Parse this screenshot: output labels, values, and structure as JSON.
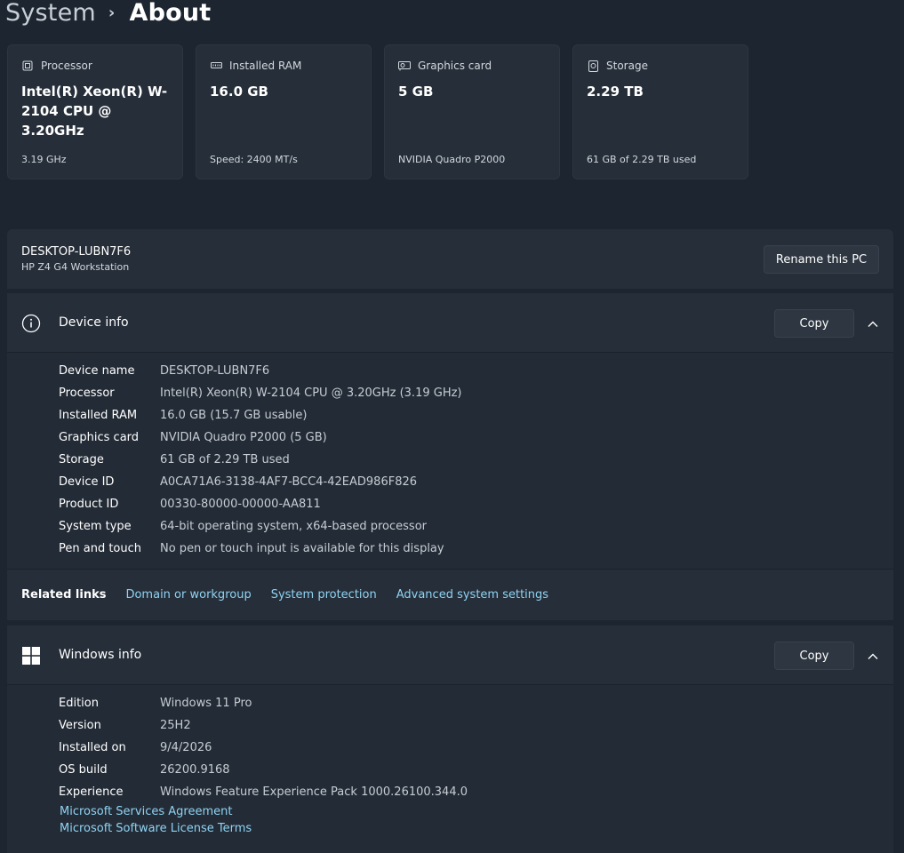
{
  "breadcrumb": {
    "parent": "System",
    "separator": "›",
    "current": "About"
  },
  "cards": [
    {
      "icon": "processor-icon",
      "label": "Processor",
      "value": "Intel(R) Xeon(R) W-2104 CPU @ 3.20GHz",
      "sub": "3.19 GHz"
    },
    {
      "icon": "ram-icon",
      "label": "Installed RAM",
      "value": "16.0 GB",
      "sub": "Speed: 2400 MT/s"
    },
    {
      "icon": "graphics-card-icon",
      "label": "Graphics card",
      "value": "5 GB",
      "sub": "NVIDIA Quadro P2000"
    },
    {
      "icon": "storage-icon",
      "label": "Storage",
      "value": "2.29 TB",
      "sub": "61 GB of 2.29 TB used"
    }
  ],
  "pc": {
    "name": "DESKTOP-LUBN7F6",
    "model": "HP Z4 G4 Workstation",
    "rename_label": "Rename this PC"
  },
  "device_info": {
    "title": "Device info",
    "copy_label": "Copy",
    "rows": [
      {
        "k": "Device name",
        "v": "DESKTOP-LUBN7F6"
      },
      {
        "k": "Processor",
        "v": "Intel(R) Xeon(R) W-2104 CPU @ 3.20GHz (3.19 GHz)"
      },
      {
        "k": "Installed RAM",
        "v": "16.0 GB (15.7 GB usable)"
      },
      {
        "k": "Graphics card",
        "v": "NVIDIA Quadro P2000 (5 GB)"
      },
      {
        "k": "Storage",
        "v": "61 GB of 2.29 TB used"
      },
      {
        "k": "Device ID",
        "v": "A0CA71A6-3138-4AF7-BCC4-42EAD986F826"
      },
      {
        "k": "Product ID",
        "v": "00330-80000-00000-AA811"
      },
      {
        "k": "System type",
        "v": "64-bit operating system, x64-based processor"
      },
      {
        "k": "Pen and touch",
        "v": "No pen or touch input is available for this display"
      }
    ]
  },
  "related_links": {
    "label": "Related links",
    "links": [
      "Domain or workgroup",
      "System protection",
      "Advanced system settings"
    ]
  },
  "windows_info": {
    "title": "Windows info",
    "copy_label": "Copy",
    "rows": [
      {
        "k": "Edition",
        "v": "Windows 11 Pro"
      },
      {
        "k": "Version",
        "v": "25H2"
      },
      {
        "k": "Installed on",
        "v": "9/4/2026"
      },
      {
        "k": "OS build",
        "v": "26200.9168"
      },
      {
        "k": "Experience",
        "v": "Windows Feature Experience Pack 1000.26100.344.0"
      }
    ],
    "links": [
      "Microsoft Services Agreement",
      "Microsoft Software License Terms"
    ]
  },
  "colors": {
    "background": "#1d2530",
    "card": "#262e39",
    "link": "#8fd3f2"
  }
}
